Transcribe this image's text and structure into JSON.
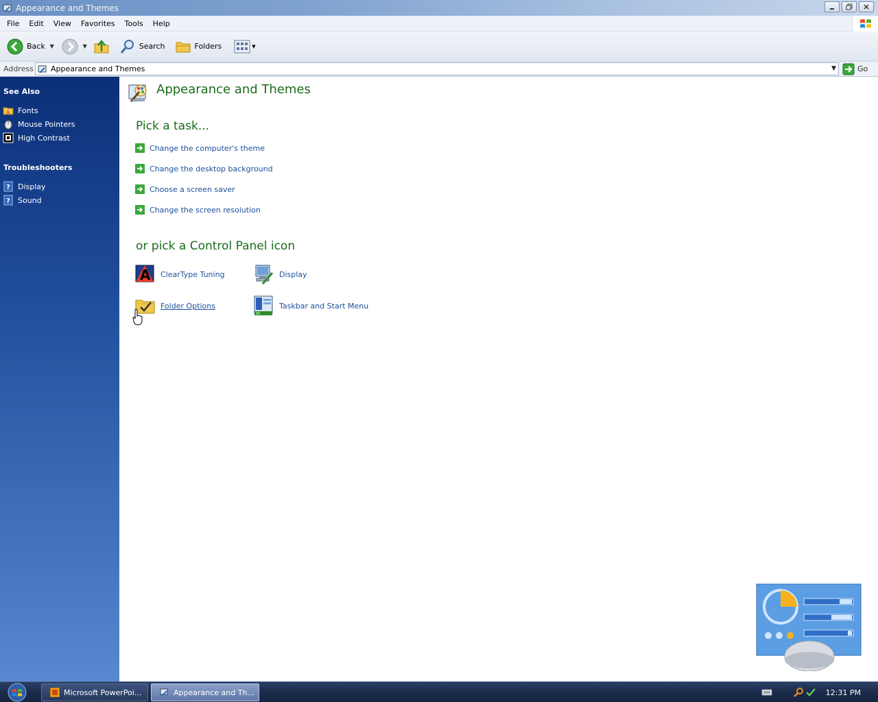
{
  "window": {
    "title": "Appearance and Themes"
  },
  "menu": [
    "File",
    "Edit",
    "View",
    "Favorites",
    "Tools",
    "Help"
  ],
  "toolbar": {
    "back_label": "Back",
    "search_label": "Search",
    "folders_label": "Folders"
  },
  "address": {
    "label": "Address",
    "value": "Appearance and Themes",
    "go_label": "Go"
  },
  "sidebar": {
    "see_also": {
      "heading": "See Also",
      "items": [
        {
          "label": "Fonts",
          "icon": "fonts-folder-icon"
        },
        {
          "label": "Mouse Pointers",
          "icon": "mouse-icon"
        },
        {
          "label": "High Contrast",
          "icon": "high-contrast-icon"
        }
      ]
    },
    "troubleshooters": {
      "heading": "Troubleshooters",
      "items": [
        {
          "label": "Display",
          "icon": "help-icon"
        },
        {
          "label": "Sound",
          "icon": "help-icon"
        }
      ]
    }
  },
  "main": {
    "title": "Appearance and Themes",
    "tasks_heading": "Pick a task...",
    "tasks": [
      "Change the computer's theme",
      "Change the desktop background",
      "Choose a screen saver",
      "Change the screen resolution"
    ],
    "icons_heading": "or pick a Control Panel icon",
    "icons": [
      {
        "label": "ClearType Tuning",
        "icon": "cleartype-icon"
      },
      {
        "label": "Display",
        "icon": "display-icon"
      },
      {
        "label": "Folder Options",
        "icon": "folder-options-icon"
      },
      {
        "label": "Taskbar and Start Menu",
        "icon": "taskbar-icon"
      }
    ]
  },
  "taskbar": {
    "buttons": [
      {
        "label": "Microsoft PowerPoi...",
        "active": false
      },
      {
        "label": "Appearance and Th...",
        "active": true
      }
    ],
    "clock": "12:31 PM"
  },
  "colors": {
    "heading_green": "#1b6b1b",
    "link_blue": "#1a4f9c",
    "sidebar_top": "#0c2f78"
  }
}
